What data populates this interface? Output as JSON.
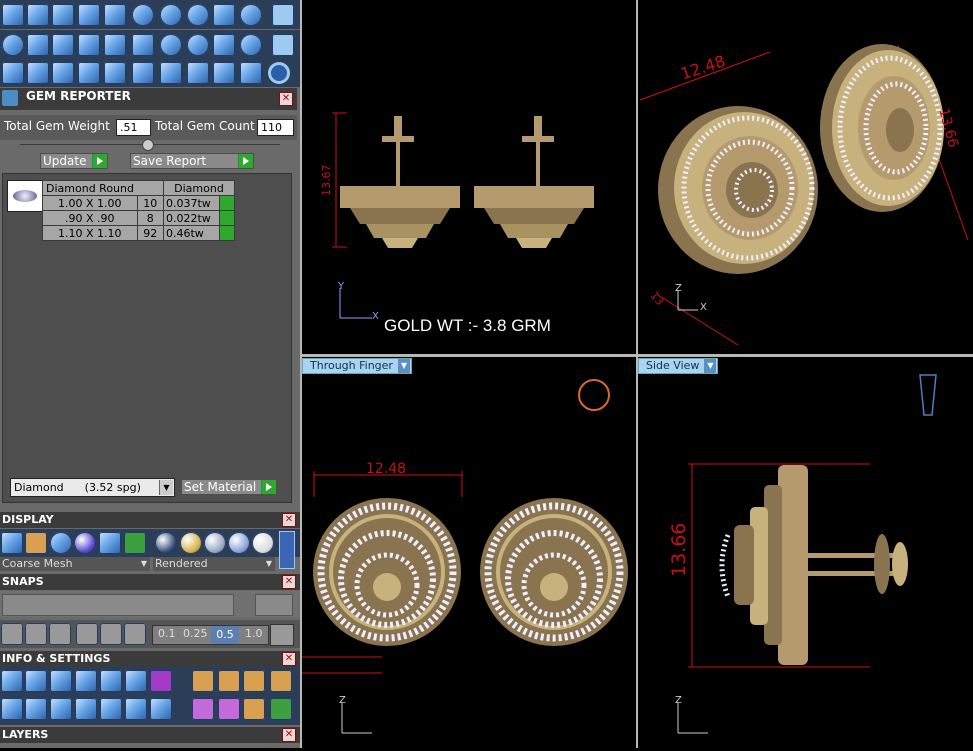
{
  "gem_reporter": {
    "title": "GEM REPORTER",
    "total_weight_label": "Total Gem Weight",
    "total_weight_value": ".51",
    "total_count_label": "Total Gem Count",
    "total_count_value": "110",
    "update_label": "Update",
    "save_label": "Save Report",
    "table_headers": [
      "Diamond Round",
      "Diamond"
    ],
    "rows": [
      {
        "size": "1.00 X 1.00",
        "count": "10",
        "weight": "0.037tw"
      },
      {
        "size": ".90 X .90",
        "count": "8",
        "weight": "0.022tw"
      },
      {
        "size": "1.10 X 1.10",
        "count": "92",
        "weight": "0.46tw"
      }
    ],
    "material_select": "Diamond      (3.52 spg)",
    "set_material_label": "Set Material"
  },
  "display": {
    "title": "DISPLAY",
    "mesh_select": "Coarse Mesh",
    "render_select": "Rendered"
  },
  "snaps": {
    "title": "SNAPS",
    "steps": [
      "0.1",
      "0.25",
      "0.5",
      "1.0"
    ]
  },
  "info": {
    "title": "INFO & SETTINGS"
  },
  "layers": {
    "title": "LAYERS"
  },
  "viewports": {
    "top_left": {
      "annotation": "GOLD WT :- 3.8 GRM",
      "dim": "13.67"
    },
    "top_right": {
      "dim_width": "12.48",
      "dim_height": "13.66",
      "dim_depth": "13"
    },
    "bottom_left": {
      "tab": "Through Finger",
      "dim_width": "12.48"
    },
    "bottom_right": {
      "tab": "Side View",
      "dim_height": "13.66"
    },
    "axis_y": "Y",
    "axis_x": "X",
    "axis_z": "Z"
  },
  "colors": {
    "accent_gold": "#b59a6e",
    "dim_red": "#d01010",
    "panel": "#6a6a6a",
    "viewport_tab": "#a9d3f2"
  }
}
